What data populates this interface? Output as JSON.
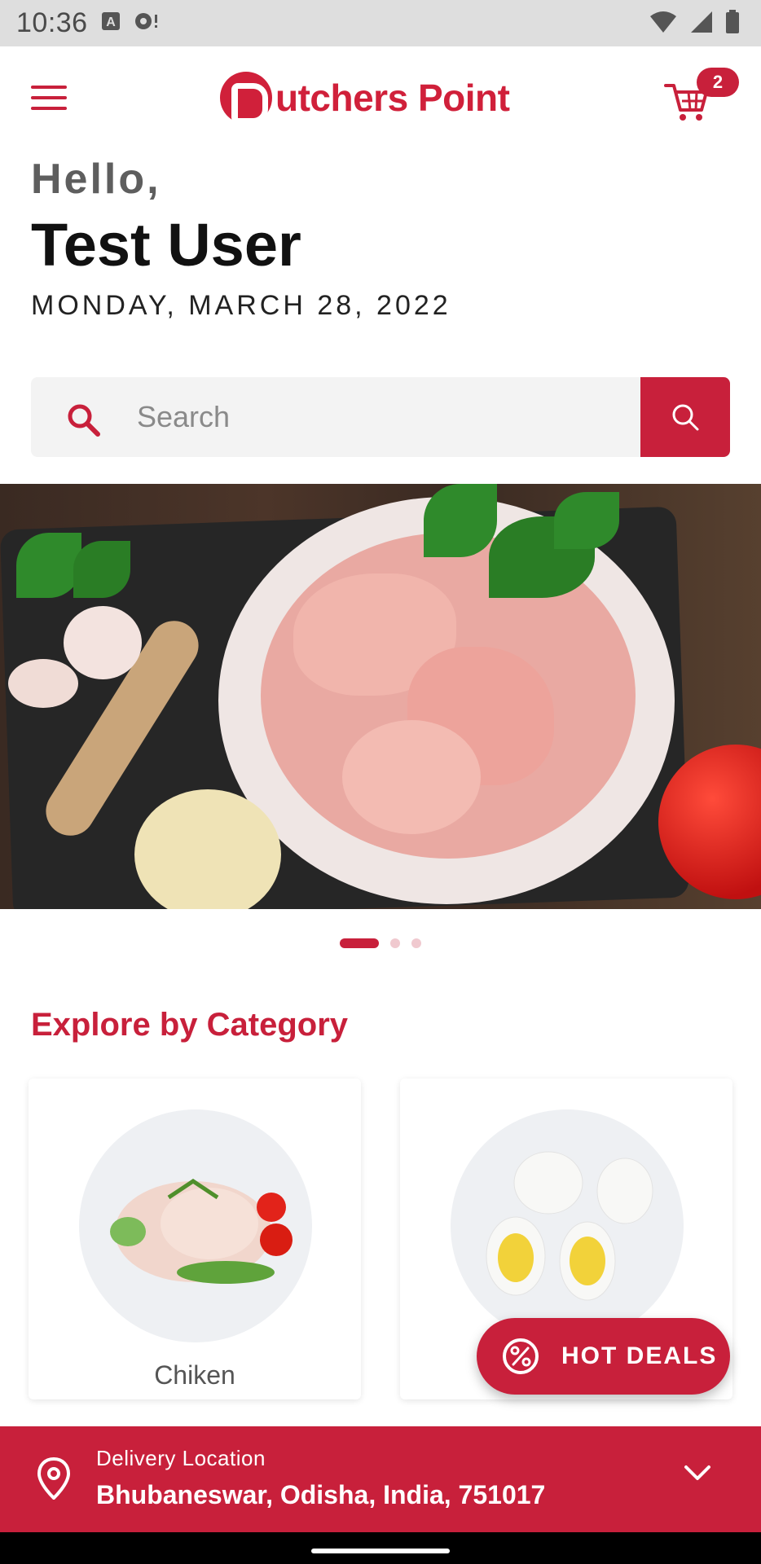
{
  "status_bar": {
    "time": "10:36"
  },
  "header": {
    "logo_text": "utchers Point",
    "cart_count": "2"
  },
  "greeting": {
    "hello": "Hello,",
    "name": "Test User",
    "date": "MONDAY, MARCH 28, 2022"
  },
  "search": {
    "placeholder": "Search"
  },
  "carousel": {
    "slides": 3,
    "active_index": 0
  },
  "categories": {
    "title": "Explore by Category",
    "items": [
      {
        "label": "Chiken"
      },
      {
        "label": ""
      }
    ]
  },
  "hot_deals": {
    "label": "HOT DEALS"
  },
  "delivery": {
    "label": "Delivery Location",
    "address": "Bhubaneswar, Odisha, India, 751017"
  },
  "colors": {
    "brand": "#c8203b",
    "logo": "#d0203a",
    "search_bg": "#f3f3f3"
  }
}
